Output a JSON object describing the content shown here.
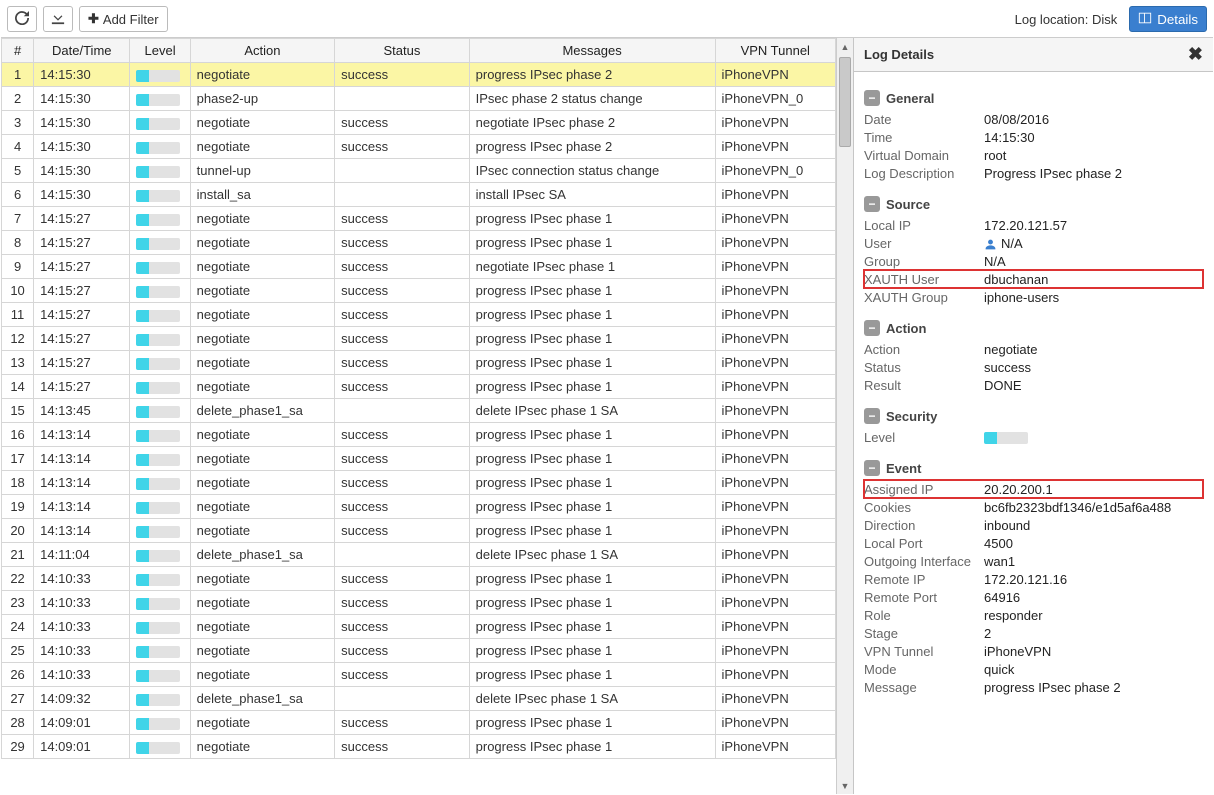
{
  "toolbar": {
    "add_filter_label": "Add Filter",
    "log_location_label": "Log location: Disk",
    "details_label": "Details"
  },
  "table": {
    "headers": {
      "idx": "#",
      "datetime": "Date/Time",
      "level": "Level",
      "action": "Action",
      "status": "Status",
      "messages": "Messages",
      "vpntunnel": "VPN Tunnel"
    },
    "rows": [
      {
        "idx": 1,
        "time": "14:15:30",
        "action": "negotiate",
        "status": "success",
        "msg": "progress IPsec phase 2",
        "vpn": "iPhoneVPN",
        "sel": true
      },
      {
        "idx": 2,
        "time": "14:15:30",
        "action": "phase2-up",
        "status": "",
        "msg": "IPsec phase 2 status change",
        "vpn": "iPhoneVPN_0"
      },
      {
        "idx": 3,
        "time": "14:15:30",
        "action": "negotiate",
        "status": "success",
        "msg": "negotiate IPsec phase 2",
        "vpn": "iPhoneVPN"
      },
      {
        "idx": 4,
        "time": "14:15:30",
        "action": "negotiate",
        "status": "success",
        "msg": "progress IPsec phase 2",
        "vpn": "iPhoneVPN"
      },
      {
        "idx": 5,
        "time": "14:15:30",
        "action": "tunnel-up",
        "status": "",
        "msg": "IPsec connection status change",
        "vpn": "iPhoneVPN_0"
      },
      {
        "idx": 6,
        "time": "14:15:30",
        "action": "install_sa",
        "status": "",
        "msg": "install IPsec SA",
        "vpn": "iPhoneVPN"
      },
      {
        "idx": 7,
        "time": "14:15:27",
        "action": "negotiate",
        "status": "success",
        "msg": "progress IPsec phase 1",
        "vpn": "iPhoneVPN"
      },
      {
        "idx": 8,
        "time": "14:15:27",
        "action": "negotiate",
        "status": "success",
        "msg": "progress IPsec phase 1",
        "vpn": "iPhoneVPN"
      },
      {
        "idx": 9,
        "time": "14:15:27",
        "action": "negotiate",
        "status": "success",
        "msg": "negotiate IPsec phase 1",
        "vpn": "iPhoneVPN"
      },
      {
        "idx": 10,
        "time": "14:15:27",
        "action": "negotiate",
        "status": "success",
        "msg": "progress IPsec phase 1",
        "vpn": "iPhoneVPN"
      },
      {
        "idx": 11,
        "time": "14:15:27",
        "action": "negotiate",
        "status": "success",
        "msg": "progress IPsec phase 1",
        "vpn": "iPhoneVPN"
      },
      {
        "idx": 12,
        "time": "14:15:27",
        "action": "negotiate",
        "status": "success",
        "msg": "progress IPsec phase 1",
        "vpn": "iPhoneVPN"
      },
      {
        "idx": 13,
        "time": "14:15:27",
        "action": "negotiate",
        "status": "success",
        "msg": "progress IPsec phase 1",
        "vpn": "iPhoneVPN"
      },
      {
        "idx": 14,
        "time": "14:15:27",
        "action": "negotiate",
        "status": "success",
        "msg": "progress IPsec phase 1",
        "vpn": "iPhoneVPN"
      },
      {
        "idx": 15,
        "time": "14:13:45",
        "action": "delete_phase1_sa",
        "status": "",
        "msg": "delete IPsec phase 1 SA",
        "vpn": "iPhoneVPN"
      },
      {
        "idx": 16,
        "time": "14:13:14",
        "action": "negotiate",
        "status": "success",
        "msg": "progress IPsec phase 1",
        "vpn": "iPhoneVPN"
      },
      {
        "idx": 17,
        "time": "14:13:14",
        "action": "negotiate",
        "status": "success",
        "msg": "progress IPsec phase 1",
        "vpn": "iPhoneVPN"
      },
      {
        "idx": 18,
        "time": "14:13:14",
        "action": "negotiate",
        "status": "success",
        "msg": "progress IPsec phase 1",
        "vpn": "iPhoneVPN"
      },
      {
        "idx": 19,
        "time": "14:13:14",
        "action": "negotiate",
        "status": "success",
        "msg": "progress IPsec phase 1",
        "vpn": "iPhoneVPN"
      },
      {
        "idx": 20,
        "time": "14:13:14",
        "action": "negotiate",
        "status": "success",
        "msg": "progress IPsec phase 1",
        "vpn": "iPhoneVPN"
      },
      {
        "idx": 21,
        "time": "14:11:04",
        "action": "delete_phase1_sa",
        "status": "",
        "msg": "delete IPsec phase 1 SA",
        "vpn": "iPhoneVPN"
      },
      {
        "idx": 22,
        "time": "14:10:33",
        "action": "negotiate",
        "status": "success",
        "msg": "progress IPsec phase 1",
        "vpn": "iPhoneVPN"
      },
      {
        "idx": 23,
        "time": "14:10:33",
        "action": "negotiate",
        "status": "success",
        "msg": "progress IPsec phase 1",
        "vpn": "iPhoneVPN"
      },
      {
        "idx": 24,
        "time": "14:10:33",
        "action": "negotiate",
        "status": "success",
        "msg": "progress IPsec phase 1",
        "vpn": "iPhoneVPN"
      },
      {
        "idx": 25,
        "time": "14:10:33",
        "action": "negotiate",
        "status": "success",
        "msg": "progress IPsec phase 1",
        "vpn": "iPhoneVPN"
      },
      {
        "idx": 26,
        "time": "14:10:33",
        "action": "negotiate",
        "status": "success",
        "msg": "progress IPsec phase 1",
        "vpn": "iPhoneVPN"
      },
      {
        "idx": 27,
        "time": "14:09:32",
        "action": "delete_phase1_sa",
        "status": "",
        "msg": "delete IPsec phase 1 SA",
        "vpn": "iPhoneVPN"
      },
      {
        "idx": 28,
        "time": "14:09:01",
        "action": "negotiate",
        "status": "success",
        "msg": "progress IPsec phase 1",
        "vpn": "iPhoneVPN"
      },
      {
        "idx": 29,
        "time": "14:09:01",
        "action": "negotiate",
        "status": "success",
        "msg": "progress IPsec phase 1",
        "vpn": "iPhoneVPN"
      }
    ]
  },
  "details": {
    "panel_title": "Log Details",
    "sections": {
      "general": {
        "title": "General",
        "fields": [
          {
            "k": "Date",
            "v": "08/08/2016"
          },
          {
            "k": "Time",
            "v": "14:15:30"
          },
          {
            "k": "Virtual Domain",
            "v": "root"
          },
          {
            "k": "Log Description",
            "v": "Progress IPsec phase 2"
          }
        ]
      },
      "source": {
        "title": "Source",
        "fields": [
          {
            "k": "Local IP",
            "v": "172.20.121.57"
          },
          {
            "k": "User",
            "v": "N/A",
            "icon": "user"
          },
          {
            "k": "Group",
            "v": "N/A"
          },
          {
            "k": "XAUTH User",
            "v": "dbuchanan",
            "hi": true
          },
          {
            "k": "XAUTH Group",
            "v": "iphone-users"
          }
        ]
      },
      "action": {
        "title": "Action",
        "fields": [
          {
            "k": "Action",
            "v": "negotiate"
          },
          {
            "k": "Status",
            "v": "success"
          },
          {
            "k": "Result",
            "v": "DONE"
          }
        ]
      },
      "security": {
        "title": "Security",
        "fields": [
          {
            "k": "Level",
            "v": "",
            "level": true
          }
        ]
      },
      "event": {
        "title": "Event",
        "fields": [
          {
            "k": "Assigned IP",
            "v": "20.20.200.1",
            "hi": true
          },
          {
            "k": "Cookies",
            "v": "bc6fb2323bdf1346/e1d5af6a488"
          },
          {
            "k": "Direction",
            "v": "inbound"
          },
          {
            "k": "Local Port",
            "v": "4500"
          },
          {
            "k": "Outgoing Interface",
            "v": "wan1"
          },
          {
            "k": "Remote IP",
            "v": "172.20.121.16"
          },
          {
            "k": "Remote Port",
            "v": "64916"
          },
          {
            "k": "Role",
            "v": "responder"
          },
          {
            "k": "Stage",
            "v": "2"
          },
          {
            "k": "VPN Tunnel",
            "v": "iPhoneVPN"
          },
          {
            "k": "Mode",
            "v": "quick"
          },
          {
            "k": "Message",
            "v": "progress IPsec phase 2"
          }
        ]
      }
    }
  }
}
